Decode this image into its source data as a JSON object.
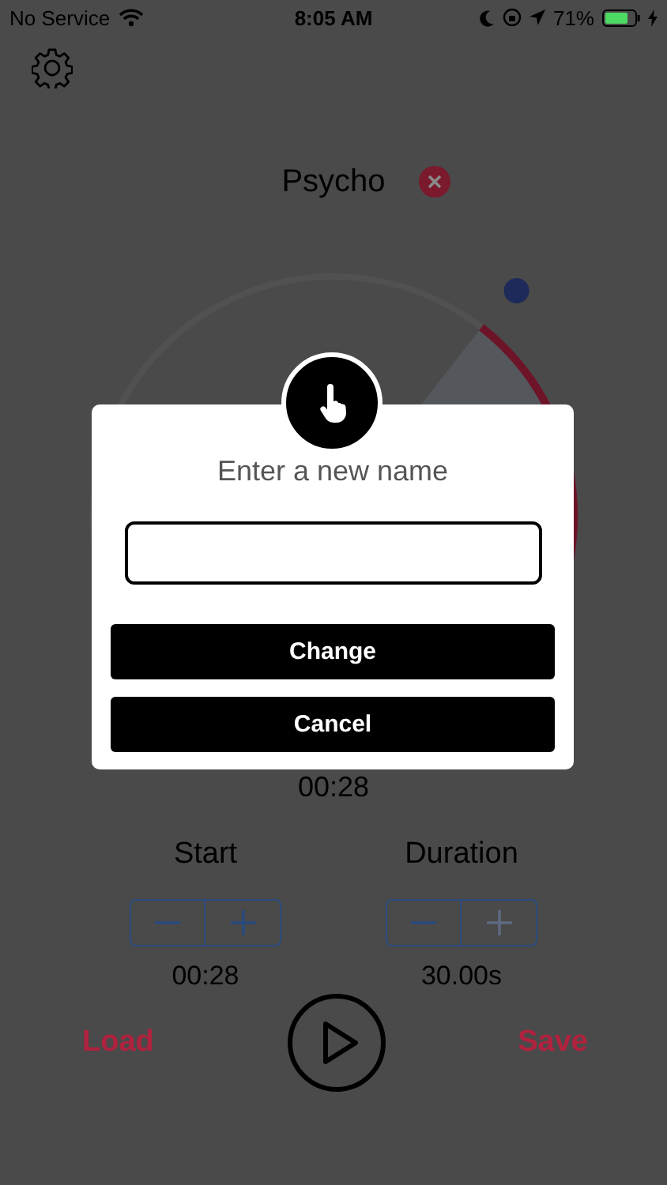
{
  "status_bar": {
    "carrier": "No Service",
    "time": "8:05 AM",
    "battery": "71%"
  },
  "title": "Psycho",
  "position": "00:28",
  "controls": [
    {
      "label": "Start",
      "value": "00:28",
      "minus_disabled": false,
      "plus_disabled": false
    },
    {
      "label": "Duration",
      "value": "30.00s",
      "minus_disabled": false,
      "plus_disabled": true
    }
  ],
  "actions": {
    "load": "Load",
    "save": "Save"
  },
  "dialog": {
    "title": "Enter a new name",
    "buttons": [
      "Change",
      "Cancel"
    ]
  }
}
